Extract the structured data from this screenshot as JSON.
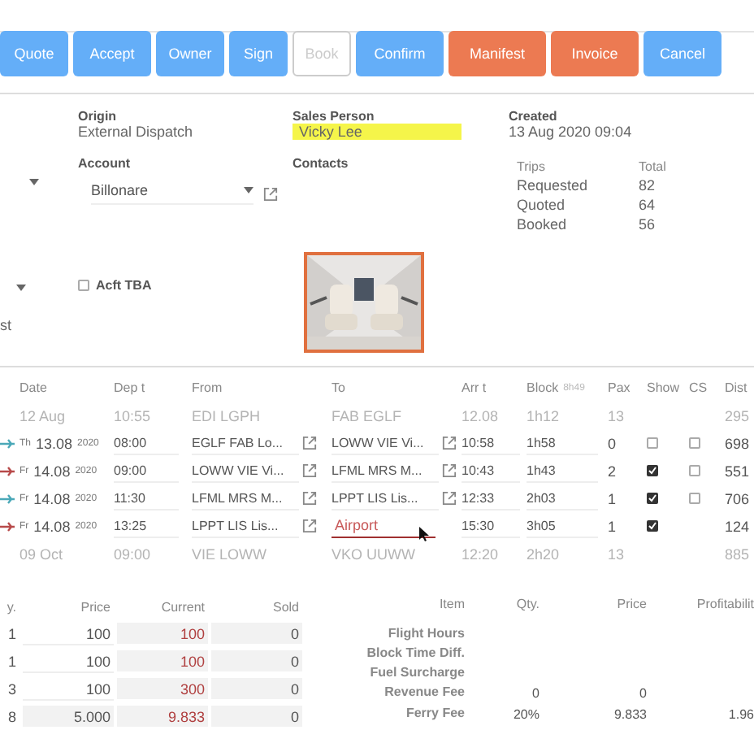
{
  "toolbar": [
    {
      "label": "Quote",
      "kind": "primary"
    },
    {
      "label": "Accept",
      "kind": "primary"
    },
    {
      "label": "Owner",
      "kind": "primary"
    },
    {
      "label": "Sign",
      "kind": "primary"
    },
    {
      "label": "Book",
      "kind": "disabled"
    },
    {
      "label": "Confirm",
      "kind": "primary"
    },
    {
      "label": "Manifest",
      "kind": "warning"
    },
    {
      "label": "Invoice",
      "kind": "warning"
    },
    {
      "label": "Cancel",
      "kind": "primary"
    }
  ],
  "info": {
    "origin": {
      "label": "Origin",
      "value": "External Dispatch"
    },
    "sales_person": {
      "label": "Sales Person",
      "value": "Vicky Lee"
    },
    "created": {
      "label": "Created",
      "value": "13 Aug 2020 09:04"
    },
    "account": {
      "label": "Account",
      "value": "Billonare"
    },
    "contacts": {
      "label": "Contacts"
    },
    "trips": {
      "columns": [
        "Trips",
        "Total"
      ],
      "rows": [
        [
          "Requested",
          "82"
        ],
        [
          "Quoted",
          "64"
        ],
        [
          "Booked",
          "56"
        ]
      ]
    },
    "acft_tba": {
      "label": "Acft TBA",
      "checked": false
    },
    "cut_text": "st"
  },
  "legs": {
    "columns": [
      "Date",
      "Dep t",
      "From",
      "To",
      "Arr t",
      "Block",
      "Pax",
      "Show",
      "CS",
      "Dist"
    ],
    "block_total": "8h49",
    "rows": [
      {
        "kind": "ghost",
        "date": "12 Aug",
        "dep": "10:55",
        "from": "EDI LGPH",
        "to": "FAB EGLF",
        "arr": "12.08",
        "block": "1h12",
        "pax": "13",
        "dist": "295"
      },
      {
        "kind": "leg",
        "color": "#4aa8b8",
        "weekday": "Th",
        "date": "13.08",
        "year": "2020",
        "dep": "08:00",
        "from": "EGLF FAB Lo...",
        "to": "LOWW VIE Vi...",
        "editing": false,
        "arr": "10:58",
        "block": "1h58",
        "pax": "0",
        "show": false,
        "cs": false,
        "dist": "698"
      },
      {
        "kind": "leg",
        "color": "#b84a4a",
        "weekday": "Fr",
        "date": "14.08",
        "year": "2020",
        "dep": "09:00",
        "from": "LOWW VIE Vi...",
        "to": "LFML MRS M...",
        "editing": false,
        "arr": "10:43",
        "block": "1h43",
        "pax": "2",
        "show": true,
        "cs": false,
        "dist": "551"
      },
      {
        "kind": "leg",
        "color": "#4aa8b8",
        "weekday": "Fr",
        "date": "14.08",
        "year": "2020",
        "dep": "11:30",
        "from": "LFML MRS M...",
        "to": "LPPT LIS Lis...",
        "editing": false,
        "arr": "12:33",
        "block": "2h03",
        "pax": "1",
        "show": true,
        "cs": false,
        "dist": "706"
      },
      {
        "kind": "leg",
        "color": "#b84a4a",
        "weekday": "Fr",
        "date": "14.08",
        "year": "2020",
        "dep": "13:25",
        "from": "LPPT LIS Lis...",
        "to": "Airport",
        "editing": true,
        "arr": "15:30",
        "block": "3h05",
        "pax": "1",
        "show": true,
        "dist": "124"
      },
      {
        "kind": "ghost",
        "date": "09 Oct",
        "dep": "09:00",
        "from": "VIE LOWW",
        "to": "VKO UUWW",
        "arr": "12:20",
        "block": "2h20",
        "pax": "13",
        "dist": "885"
      }
    ]
  },
  "costs": {
    "columns": [
      "y.",
      "Price",
      "Current",
      "Sold"
    ],
    "rows": [
      {
        "qty": "1",
        "price": "100",
        "current": "100",
        "sold": "0"
      },
      {
        "qty": "1",
        "price": "100",
        "current": "100",
        "sold": "0"
      },
      {
        "qty": "3",
        "price": "100",
        "current": "300",
        "sold": "0"
      },
      {
        "qty": "8",
        "price": "5.000",
        "current": "9.833",
        "sold": "0"
      }
    ]
  },
  "fees": {
    "columns": [
      "Item",
      "Qty.",
      "Price",
      "Profitabilit"
    ],
    "rows": [
      {
        "item": "Flight Hours"
      },
      {
        "item": "Block Time Diff."
      },
      {
        "item": "Fuel Surcharge"
      },
      {
        "item": "Revenue Fee",
        "qty": "0",
        "price": "0"
      },
      {
        "item": "Ferry Fee",
        "qty": "20%",
        "price": "9.833",
        "profit": "1.96"
      }
    ]
  }
}
